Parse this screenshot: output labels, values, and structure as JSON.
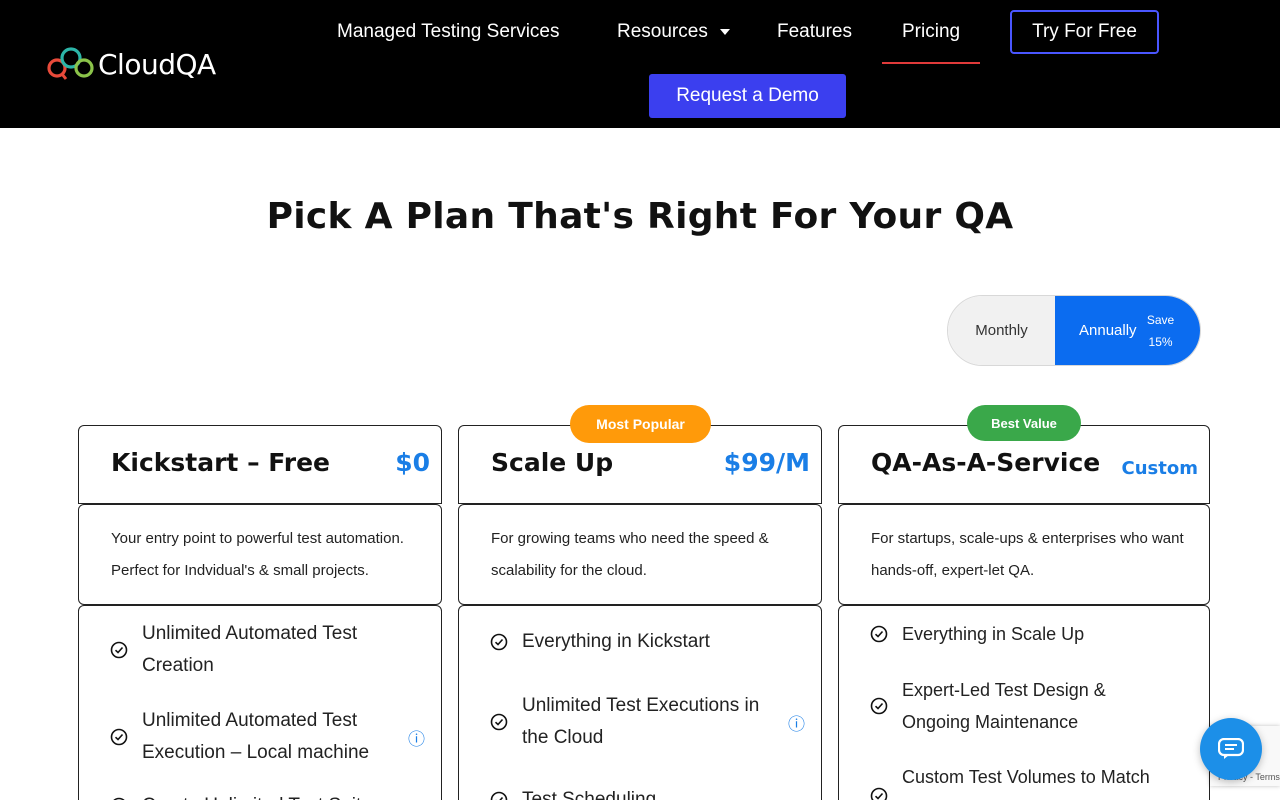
{
  "header": {
    "logo_text": "CloudQA",
    "nav": {
      "managed": "Managed Testing Services",
      "resources": "Resources",
      "features": "Features",
      "pricing": "Pricing"
    },
    "try_free": "Try For Free",
    "request_demo": "Request a Demo"
  },
  "main": {
    "title": "Pick A Plan That's Right For Your QA",
    "billing": {
      "monthly": "Monthly",
      "annually": "Annually",
      "save_line1": "Save",
      "save_line2": "15%"
    },
    "plans": [
      {
        "name": "Kickstart – Free",
        "price": "$0",
        "desc_line1": "Your entry point to powerful test automation.",
        "desc_line2": "Perfect for Indvidual's & small projects.",
        "features": [
          "Unlimited Automated Test",
          "Creation",
          "Unlimited Automated Test",
          "Execution – Local machine",
          "Create Unlimited Test Suites"
        ]
      },
      {
        "name": "Scale Up",
        "price": "$99/M",
        "badge": "Most Popular",
        "desc_line1": "For growing teams who need the speed &",
        "desc_line2": "scalability for the cloud.",
        "features": [
          "Everything in Kickstart",
          "Unlimited Test Executions in",
          "the Cloud",
          "Test Scheduling"
        ]
      },
      {
        "name": "QA-As-A-Service",
        "price": "Custom",
        "badge": "Best Value",
        "desc_line1": "For startups, scale-ups & enterprises who want",
        "desc_line2": "hands-off, expert-let QA.",
        "features": [
          "Everything in Scale Up",
          "Expert-Led Test Design &",
          "Ongoing Maintenance",
          "Custom Test Volumes to Match"
        ]
      }
    ]
  },
  "recaptcha": {
    "links": "Privacy - Terms"
  },
  "colors": {
    "accent_blue": "#1a7ee6",
    "toggle_active": "#0b6cf0",
    "demo_button": "#3b3fef",
    "badge_popular": "#ff9a0a",
    "badge_value": "#3aa84a",
    "nav_active_underline": "#e03a3a"
  }
}
